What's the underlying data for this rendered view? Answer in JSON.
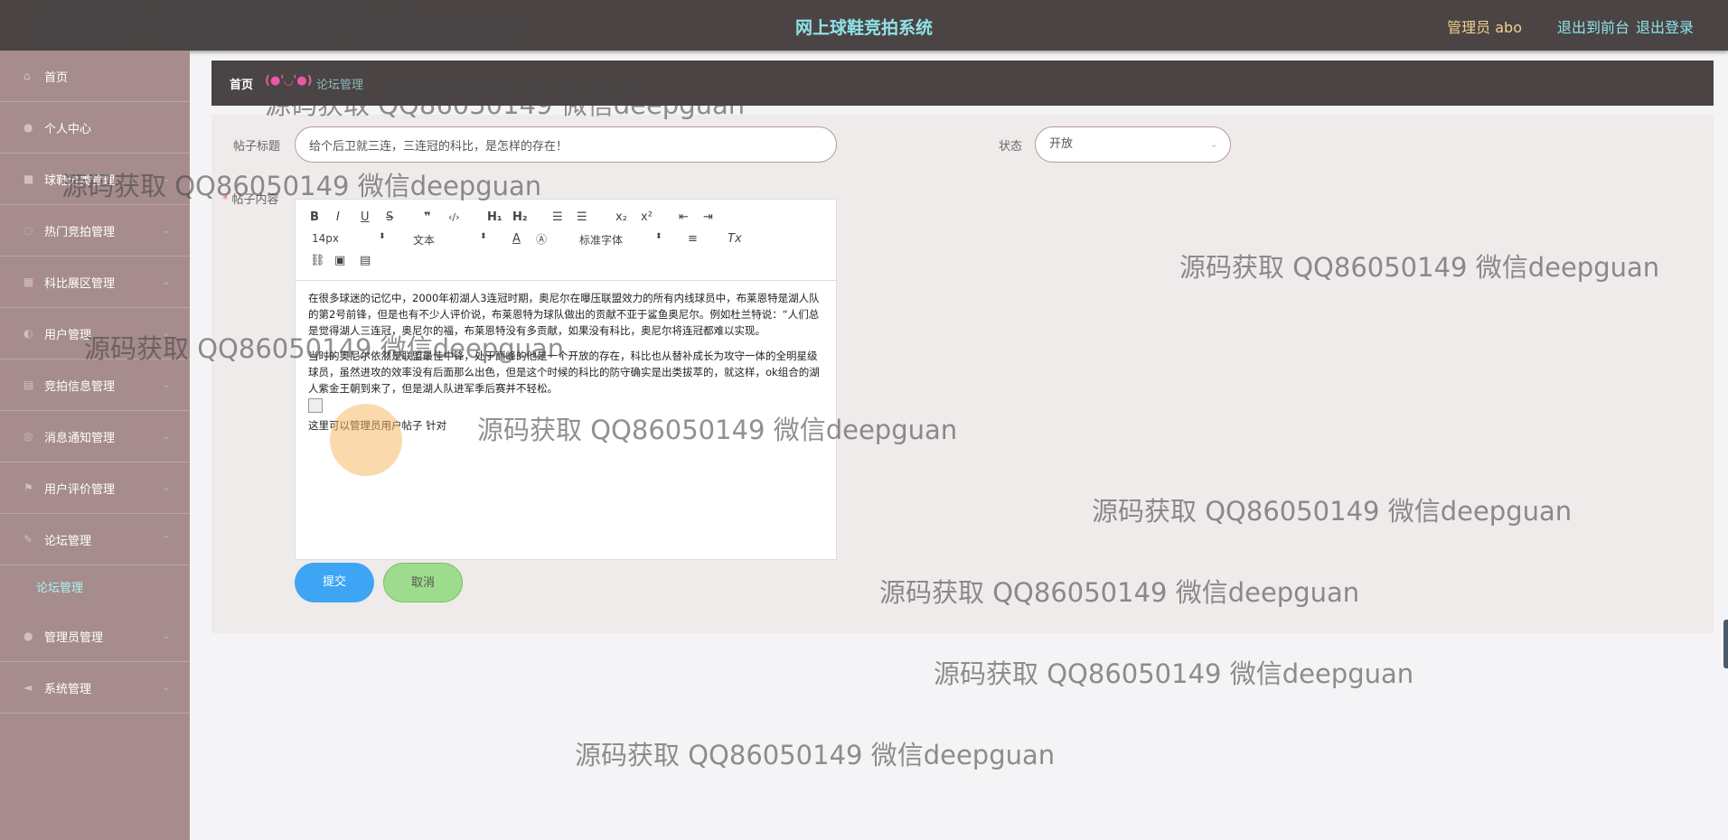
{
  "header": {
    "title": "网上球鞋竞拍系统",
    "admin_label": "管理员 abo",
    "front_link": "退出到前台",
    "logout_link": "退出登录"
  },
  "sidebar": {
    "items": [
      {
        "label": "首页",
        "icon": "home-icon"
      },
      {
        "label": "个人中心",
        "icon": "user-icon"
      },
      {
        "label": "球鞋分类管理",
        "icon": "folder-icon"
      },
      {
        "label": "热门竞拍管理",
        "icon": "clock-icon"
      },
      {
        "label": "科比展区管理",
        "icon": "grid-icon"
      },
      {
        "label": "用户管理",
        "icon": "users-icon"
      },
      {
        "label": "竞拍信息管理",
        "icon": "document-icon"
      },
      {
        "label": "消息通知管理",
        "icon": "bell-icon"
      },
      {
        "label": "用户评价管理",
        "icon": "comment-icon"
      },
      {
        "label": "论坛管理",
        "icon": "forum-icon"
      },
      {
        "label": "管理员管理",
        "icon": "admin-icon"
      },
      {
        "label": "系统管理",
        "icon": "settings-icon"
      }
    ],
    "submenu": {
      "label": "论坛管理"
    }
  },
  "breadcrumb": {
    "home": "首页",
    "separator": "(●'◡'●)",
    "current": "论坛管理"
  },
  "form": {
    "title_label": "帖子标题",
    "title_value": "给个后卫就三连，三连冠的科比，是怎样的存在！",
    "status_label": "状态",
    "status_value": "开放",
    "content_label": "帖子内容",
    "submit_label": "提交",
    "cancel_label": "取消"
  },
  "editor": {
    "font_size": "14px",
    "paragraph_type": "文本",
    "font_family": "标准字体",
    "paragraphs": [
      "在很多球迷的记忆中，2000年初湖人3连冠时期，奥尼尔在曝压联盟效力的所有内线球员中，布莱恩特是湖人队的第2号前锋，但是也有不少人评价说，布莱恩特为球队做出的贡献不亚于鲨鱼奥尼尔。例如杜兰特说：“人们总是觉得湖人三连冠，奥尼尔的福，布莱恩特没有多贡献，如果没有科比，奥尼尔将连冠都难以实现。",
      "当时的奥尼尔依然是联盟最佳中锋，处于巅峰的他是一个开放的存在，科比也从替补成长为攻守一体的全明星级球员，虽然进攻的效率没有后面那么出色，但是这个时候的科比的防守确实是出类拔萃的，就这样，ok组合的湖人紫金王朝到来了，但是湖人队进军季后赛并不轻松。"
    ],
    "typed_line": "这里可以管理员用户帖子 针对"
  },
  "watermark": "源码获取 QQ86050149 微信deepguan"
}
